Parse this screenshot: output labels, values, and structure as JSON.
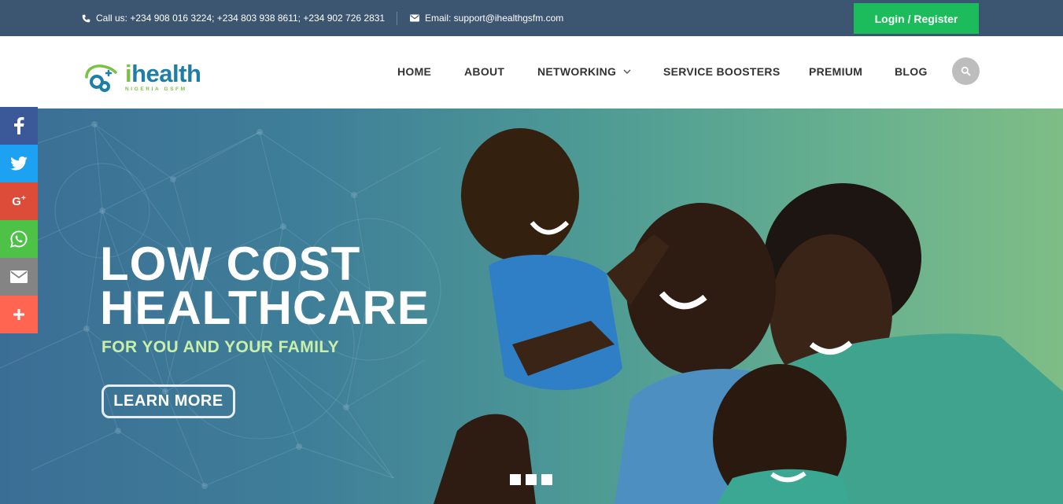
{
  "topbar": {
    "phone_text": "Call us: +234 908 016 3224; +234 803 938 8611; +234 902 726 2831",
    "email_text": "Email: support@ihealthgsfm.com",
    "login_label": "Login / Register"
  },
  "logo": {
    "part1": "ihealth",
    "tagline": "NIGERIA GSFM"
  },
  "nav": {
    "items": [
      "HOME",
      "ABOUT",
      "NETWORKING",
      "SERVICE BOOSTERS",
      "PREMIUM",
      "BLOG"
    ]
  },
  "hero": {
    "headline_line1": "LOW COST",
    "headline_line2": "HEALTHCARE",
    "subline": "FOR YOU AND YOUR FAMILY",
    "button_label": "LEARN MORE"
  },
  "social": [
    {
      "name": "facebook",
      "color": "#3b5998"
    },
    {
      "name": "twitter",
      "color": "#1da1f2"
    },
    {
      "name": "google-plus",
      "color": "#dd4b39"
    },
    {
      "name": "whatsapp",
      "color": "#4dc247"
    },
    {
      "name": "email",
      "color": "#848484"
    },
    {
      "name": "more",
      "color": "#ff6550"
    }
  ],
  "colors": {
    "topbar_bg": "#3c5571",
    "login_bg": "#1cbc5c",
    "logo_green": "#7cc242",
    "logo_blue": "#1d7fa8"
  }
}
